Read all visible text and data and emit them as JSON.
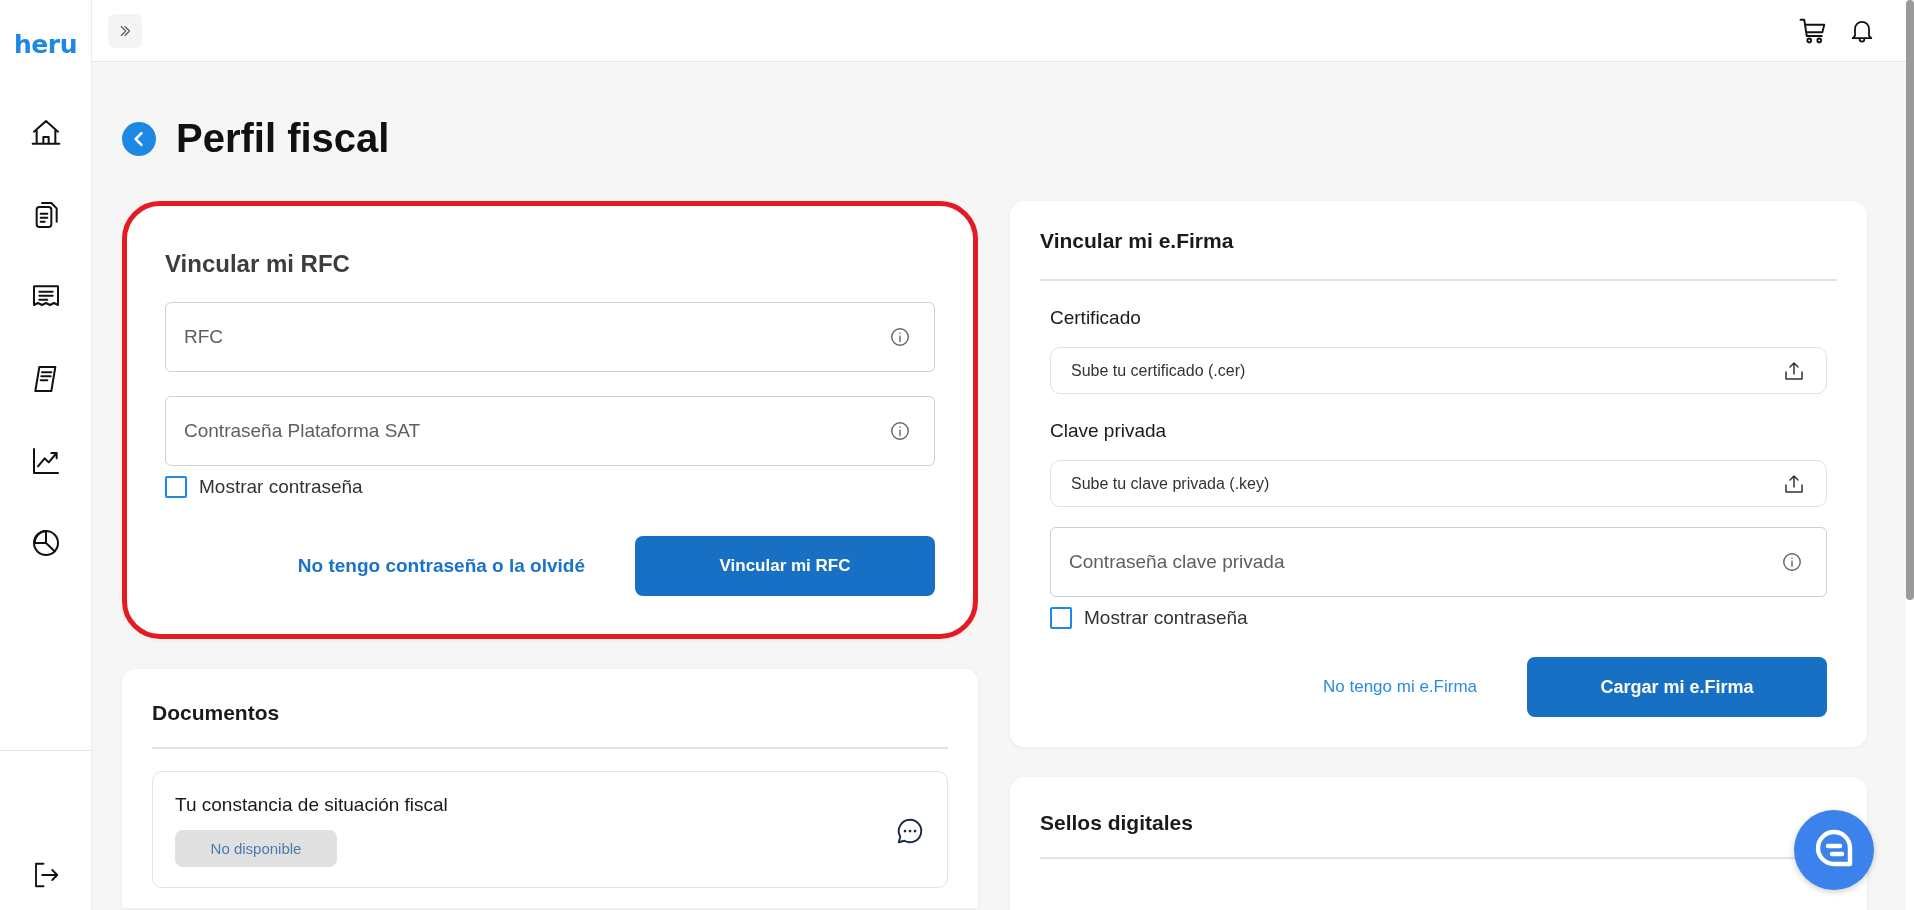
{
  "sidebar": {
    "logo": "heru"
  },
  "page": {
    "title": "Perfil fiscal"
  },
  "rfc_card": {
    "highlighted": true,
    "title": "Vincular mi RFC",
    "fields": [
      {
        "placeholder": "RFC"
      },
      {
        "placeholder": "Contraseña Plataforma SAT"
      }
    ],
    "show_password": {
      "label": "Mostrar contraseña",
      "checked": false
    },
    "link": "No tengo contraseña o la olvidé",
    "button": "Vincular mi RFC"
  },
  "efirma_card": {
    "title": "Vincular mi e.Firma",
    "uploads": [
      {
        "label": "Certificado",
        "text": "Sube tu certificado (.cer)"
      },
      {
        "label": "Clave privada",
        "text": "Sube tu clave privada (.key)"
      }
    ],
    "password": {
      "placeholder": "Contraseña clave privada"
    },
    "show_password": {
      "label": "Mostrar contraseña",
      "checked": false
    },
    "link": "No tengo mi e.Firma",
    "button": "Cargar mi e.Firma"
  },
  "documents": {
    "title": "Documentos",
    "items": [
      {
        "title": "Tu constancia de situación fiscal",
        "status": "No disponible"
      }
    ]
  },
  "sellos": {
    "title": "Sellos digitales"
  }
}
